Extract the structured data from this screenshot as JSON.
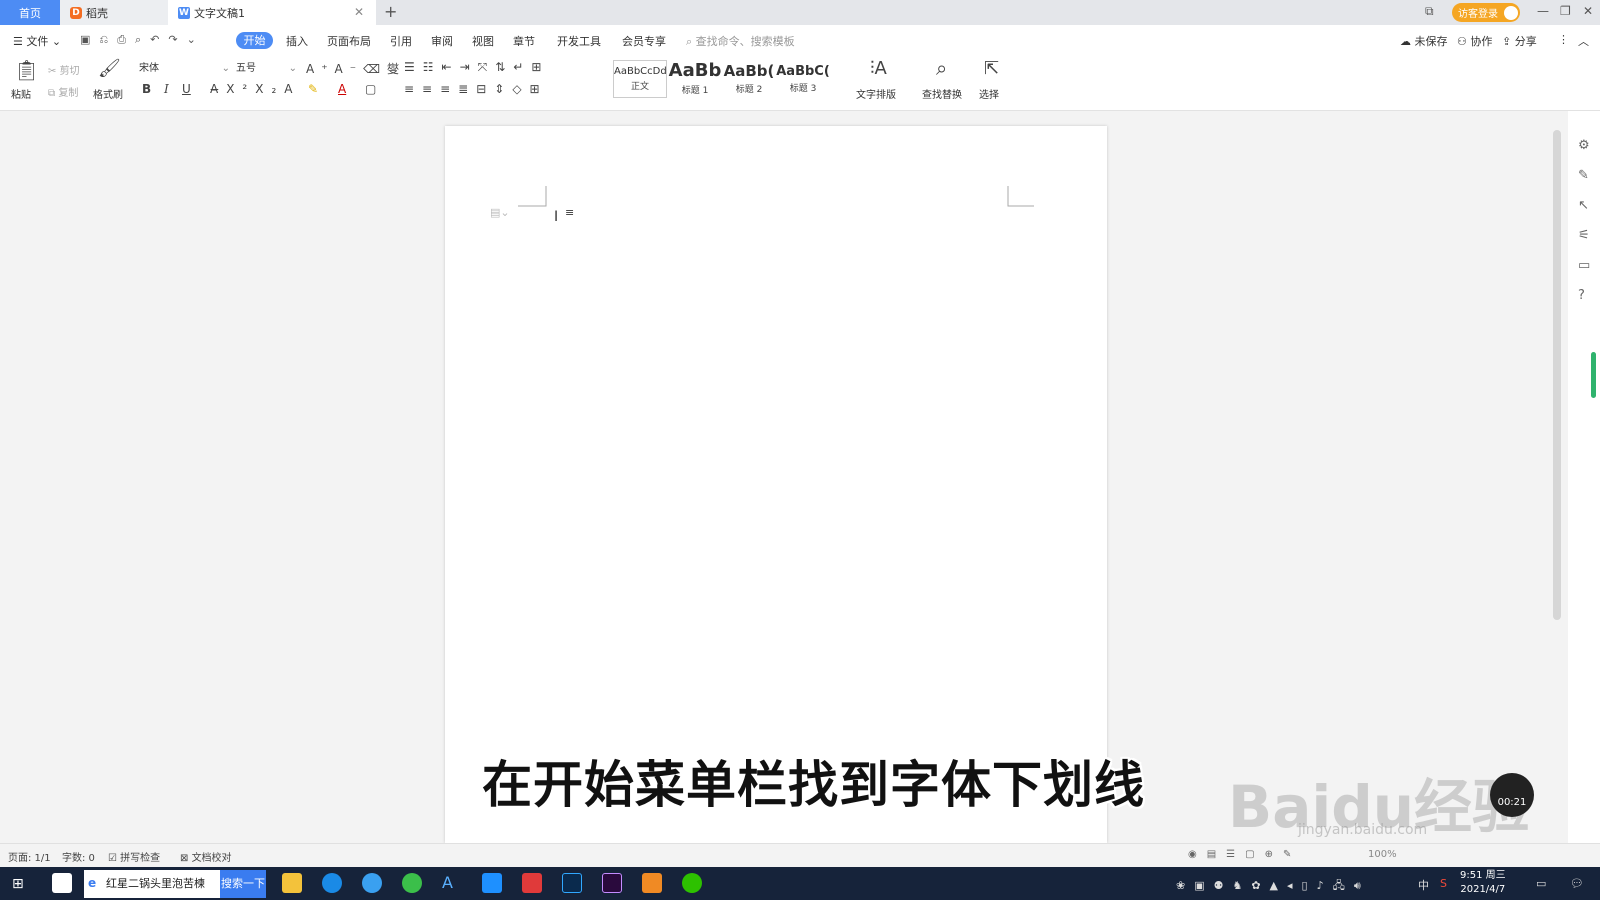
{
  "tabs": {
    "home": "首页",
    "daoke": "稻壳",
    "document": "文字文稿1",
    "login": "访客登录"
  },
  "menu": {
    "file": "文件",
    "items": [
      "开始",
      "插入",
      "页面布局",
      "引用",
      "审阅",
      "视图",
      "章节",
      "开发工具",
      "会员专享"
    ],
    "search_placeholder": "查找命令、搜索模板",
    "unsaved": "未保存",
    "collaborate": "协作",
    "share": "分享"
  },
  "ribbon": {
    "paste": "粘贴",
    "cut": "剪切",
    "copy": "复制",
    "format_painter": "格式刷",
    "font_name": "宋体",
    "font_size": "五号",
    "styles": [
      {
        "preview": "AaBbCcDd",
        "label": "正文"
      },
      {
        "preview": "AaBb",
        "label": "标题 1"
      },
      {
        "preview": "AaBb(",
        "label": "标题 2"
      },
      {
        "preview": "AaBbC(",
        "label": "标题 3"
      }
    ],
    "text_layout": "文字排版",
    "find_replace": "查找替换",
    "select": "选择"
  },
  "subtitle": "在开始菜单栏找到字体下划线",
  "watermark": "Baidu经验",
  "watermark_sub": "jingyan.baidu.com",
  "timer": "00:21",
  "status": {
    "page": "页面: 1/1",
    "words": "字数: 0",
    "spell_check": "拼写检查",
    "doc_check": "文档校对",
    "zoom": "100%"
  },
  "taskbar": {
    "search_text": "红星二锅头里泡苦楝",
    "search_button": "搜索一下",
    "time": "9:51 周三",
    "date": "2021/4/7",
    "ime": "中"
  },
  "colors": {
    "accent": "#4d8cf4",
    "login": "#f5a623",
    "taskbar": "#16233a"
  }
}
